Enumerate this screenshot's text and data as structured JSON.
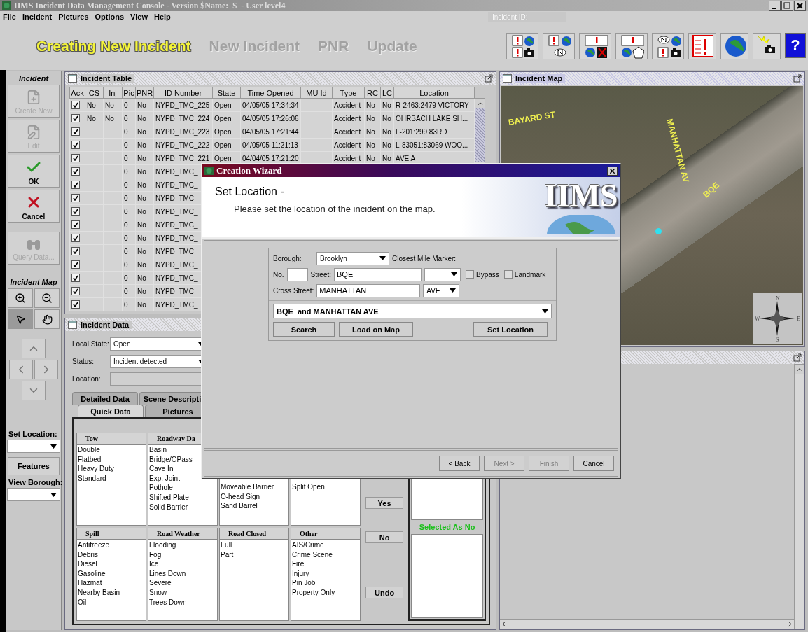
{
  "window": {
    "title": "IIMS Incident Data Management Console - Version $Name:  $  - User level4"
  },
  "menu": [
    "File",
    "Incident",
    "Pictures",
    "Options",
    "View",
    "Help"
  ],
  "incident_id": {
    "label": "Incident ID:"
  },
  "modes": [
    {
      "label": "Creating New Incident",
      "selected": true
    },
    {
      "label": "New Incident",
      "selected": false
    },
    {
      "label": "PNR",
      "selected": false
    },
    {
      "label": "Update",
      "selected": false
    }
  ],
  "toolbar": [
    {
      "kind": "alert-globe-camera"
    },
    {
      "kind": "alert-badge"
    },
    {
      "kind": "alert-blocked"
    },
    {
      "kind": "alert-shape"
    },
    {
      "kind": "badge-camera"
    },
    {
      "kind": "alert-sheet"
    },
    {
      "kind": "globe"
    },
    {
      "kind": "camera-flash"
    },
    {
      "kind": "help",
      "label": "?"
    }
  ],
  "sidebar": {
    "title": "Incident",
    "actions": [
      {
        "kind": "create",
        "label": "Create New",
        "disabled": true
      },
      {
        "kind": "edit",
        "label": "Edit",
        "disabled": true
      },
      {
        "kind": "ok",
        "label": "OK",
        "disabled": false
      },
      {
        "kind": "cancel",
        "label": "Cancel",
        "disabled": false
      },
      {
        "kind": "query",
        "label": "Query Data...",
        "disabled": true
      }
    ],
    "map_title": "Incident Map",
    "map_tools": [
      {
        "kind": "zoom-in",
        "selected": false
      },
      {
        "kind": "zoom-out",
        "selected": false
      },
      {
        "kind": "pointer",
        "selected": true
      },
      {
        "kind": "pan",
        "selected": false
      }
    ],
    "set_location": "Set Location:",
    "features": "Features",
    "view_borough": "View Borough:"
  },
  "incident_table": {
    "title": "Incident Table",
    "columns": [
      "Ack",
      "CS",
      "Inj",
      "Pic",
      "PNR",
      "ID Number",
      "State",
      "Time Opened",
      "MU Id",
      "Type",
      "RC",
      "LC",
      "Location"
    ],
    "rows": [
      {
        "ack": true,
        "cs": "No",
        "inj": "No",
        "pic": "0",
        "pnr": "No",
        "id": "NYPD_TMC_225",
        "state": "Open",
        "time": "04/05/05 17:34:34",
        "type": "Accident",
        "rc": "No",
        "lc": "No",
        "location": "R-2463:2479 VICTORY"
      },
      {
        "ack": true,
        "cs": "No",
        "inj": "No",
        "pic": "0",
        "pnr": "No",
        "id": "NYPD_TMC_224",
        "state": "Open",
        "time": "04/05/05 17:26:06",
        "type": "Accident",
        "rc": "No",
        "lc": "No",
        "location": "OHRBACH LAKE SH..."
      },
      {
        "ack": true,
        "pic": "0",
        "pnr": "No",
        "id": "NYPD_TMC_223",
        "state": "Open",
        "time": "04/05/05 17:21:44",
        "type": "Accident",
        "rc": "No",
        "lc": "No",
        "location": "L-201:299 83RD"
      },
      {
        "ack": true,
        "pic": "0",
        "pnr": "No",
        "id": "NYPD_TMC_222",
        "state": "Open",
        "time": "04/05/05 11:21:13",
        "type": "Accident",
        "rc": "No",
        "lc": "No",
        "location": "L-83051:83069 WOO..."
      },
      {
        "ack": true,
        "pic": "0",
        "pnr": "No",
        "id": "NYPD_TMC_221",
        "state": "Open",
        "time": "04/04/05 17:21:20",
        "type": "Accident",
        "rc": "No",
        "lc": "No",
        "location": "AVE A"
      },
      {
        "ack": true,
        "pic": "0",
        "pnr": "No",
        "id": "NYPD_TMC_"
      },
      {
        "ack": true,
        "pic": "0",
        "pnr": "No",
        "id": "NYPD_TMC_"
      },
      {
        "ack": true,
        "pic": "0",
        "pnr": "No",
        "id": "NYPD_TMC_"
      },
      {
        "ack": true,
        "pic": "0",
        "pnr": "No",
        "id": "NYPD_TMC_"
      },
      {
        "ack": true,
        "pic": "0",
        "pnr": "No",
        "id": "NYPD_TMC_"
      },
      {
        "ack": true,
        "pic": "0",
        "pnr": "No",
        "id": "NYPD_TMC_"
      },
      {
        "ack": true,
        "pic": "0",
        "pnr": "No",
        "id": "NYPD_TMC_"
      },
      {
        "ack": true,
        "pic": "0",
        "pnr": "No",
        "id": "NYPD_TMC_"
      },
      {
        "ack": true,
        "pic": "0",
        "pnr": "No",
        "id": "NYPD_TMC_"
      },
      {
        "ack": true,
        "pic": "0",
        "pnr": "No",
        "id": "NYPD_TMC_"
      },
      {
        "ack": true,
        "pic": "0",
        "pnr": "No",
        "id": "NYPD_TMC_"
      }
    ]
  },
  "incident_data": {
    "title": "Incident Data",
    "fields": [
      {
        "kind": "combo",
        "label": "Local State:",
        "value": "Open"
      },
      {
        "kind": "combo",
        "label": "Status:",
        "value": "Incident detected"
      },
      {
        "kind": "text",
        "label": "Location:"
      }
    ],
    "tab_rows": [
      [
        {
          "label": "Detailed Data",
          "selected": false
        },
        {
          "label": "Scene Descripti",
          "selected": false
        }
      ],
      [
        {
          "label": "Quick Data",
          "selected": true
        },
        {
          "label": "Pictures",
          "selected": false
        }
      ]
    ],
    "groups": [
      [
        {
          "kind": "titled",
          "header": "Tow",
          "items": [
            "Double",
            "Flatbed",
            "Heavy Duty",
            "Standard"
          ]
        },
        {
          "kind": "titled",
          "header": "Roadway Da",
          "items": [
            "Basin",
            "Bridge/OPass",
            "Cave In",
            "Exp. Joint",
            "Pothole",
            "Shifted Plate",
            "Solid Barrier"
          ]
        },
        {
          "kind": "obscured",
          "items": [
            "Moveable Barrier",
            "O-head Sign",
            "Sand Barrel"
          ]
        },
        {
          "kind": "obscured",
          "items": [
            "Split Open"
          ]
        }
      ],
      [
        {
          "kind": "titled",
          "header": "Spill",
          "items": [
            "Antifreeze",
            "Debris",
            "Diesel",
            "Gasoline",
            "Hazmat",
            "Nearby Basin",
            "Oil"
          ]
        },
        {
          "kind": "titled",
          "header": "Road Weather",
          "items": [
            "Flooding",
            "Fog",
            "Ice",
            "Lines Down",
            "Severe",
            "Snow",
            "Trees Down"
          ]
        },
        {
          "kind": "titled",
          "header": "Road Closed",
          "items": [
            "Full",
            "Part"
          ]
        },
        {
          "kind": "titled",
          "header": "Other",
          "items": [
            "AIS/Crime",
            "Crime Scene",
            "Fire",
            "Injury",
            "Pin Job",
            "Property Only"
          ]
        }
      ]
    ],
    "buttons": [
      "Yes",
      "No",
      "Undo"
    ],
    "no_label": "Selected As No"
  },
  "incident_map": {
    "title": "Incident Map",
    "labels": [
      "BAYARD ST",
      "MANHATTAN AV",
      "BQE"
    ],
    "compass": [
      "N",
      "W",
      "E",
      "S"
    ]
  },
  "dialog": {
    "title": "Creation Wizard",
    "heading": "Set Location -",
    "instruction": "Please set the location of the incident on the map.",
    "logo": "IIMS",
    "borough": {
      "label": "Borough:",
      "value": "Brooklyn"
    },
    "mile_marker": {
      "label": "Closest Mile Marker:"
    },
    "number": {
      "label": "No."
    },
    "street": {
      "label": "Street:",
      "value": "BQE"
    },
    "options": [
      {
        "label": "Bypass",
        "checked": false
      },
      {
        "label": "Landmark",
        "checked": false
      }
    ],
    "cross_street": {
      "label": "Cross Street:",
      "value": "MANHATTAN",
      "suffix": "AVE"
    },
    "match": "BQE  and MANHATTAN AVE",
    "actions": [
      "Search",
      "Load on Map",
      "Set Location"
    ],
    "footer": [
      {
        "label": "< Back",
        "disabled": false
      },
      {
        "label": "Next >",
        "disabled": true
      },
      {
        "label": "Finish",
        "disabled": true
      },
      {
        "label": "Cancel",
        "disabled": false
      }
    ]
  }
}
